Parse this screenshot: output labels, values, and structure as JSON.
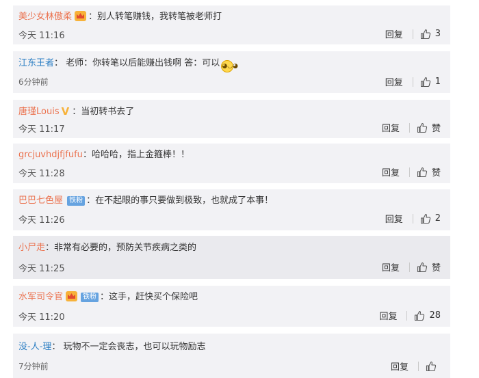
{
  "comments": [
    {
      "user": "美少女林傲柔",
      "text": "别人转笔赚钱，我转笔被老师打",
      "time": "今天 11:16",
      "reply": "回复",
      "likes": "3"
    },
    {
      "user": "江东王者",
      "text": "老师：你转笔以后能赚出钱啊 答：可以",
      "time": "6分钟前",
      "reply": "回复",
      "likes": "1"
    },
    {
      "user": "唐瑾Louis",
      "text": "当初转书去了",
      "time": "今天 11:17",
      "reply": "回复",
      "likes": "赞"
    },
    {
      "user": "grcjuvhdjfjfufu",
      "text": "哈哈哈，指上金箍棒！！",
      "time": "今天 11:28",
      "reply": "回复",
      "likes": "赞"
    },
    {
      "user": "巴巴七色屋",
      "badge": "铁粉",
      "text": "在不起眼的事只要做到极致，也就成了本事！",
      "time": "今天 11:26",
      "reply": "回复",
      "likes": "2"
    },
    {
      "user": "小尸走",
      "text": "非常有必要的，预防关节疾病之类的",
      "time": "今天 11:25",
      "reply": "回复",
      "likes": "赞"
    },
    {
      "user": "水军司令官",
      "badge": "铁粉",
      "text": "这手，赶快买个保险吧",
      "time": "今天 11:20",
      "reply": "回复",
      "likes": "28"
    },
    {
      "user": "没-人-理",
      "text": "玩物不一定会丧志，也可以玩物励志",
      "time": "7分钟前",
      "reply": "回复",
      "likes": ""
    }
  ],
  "colon": "："
}
